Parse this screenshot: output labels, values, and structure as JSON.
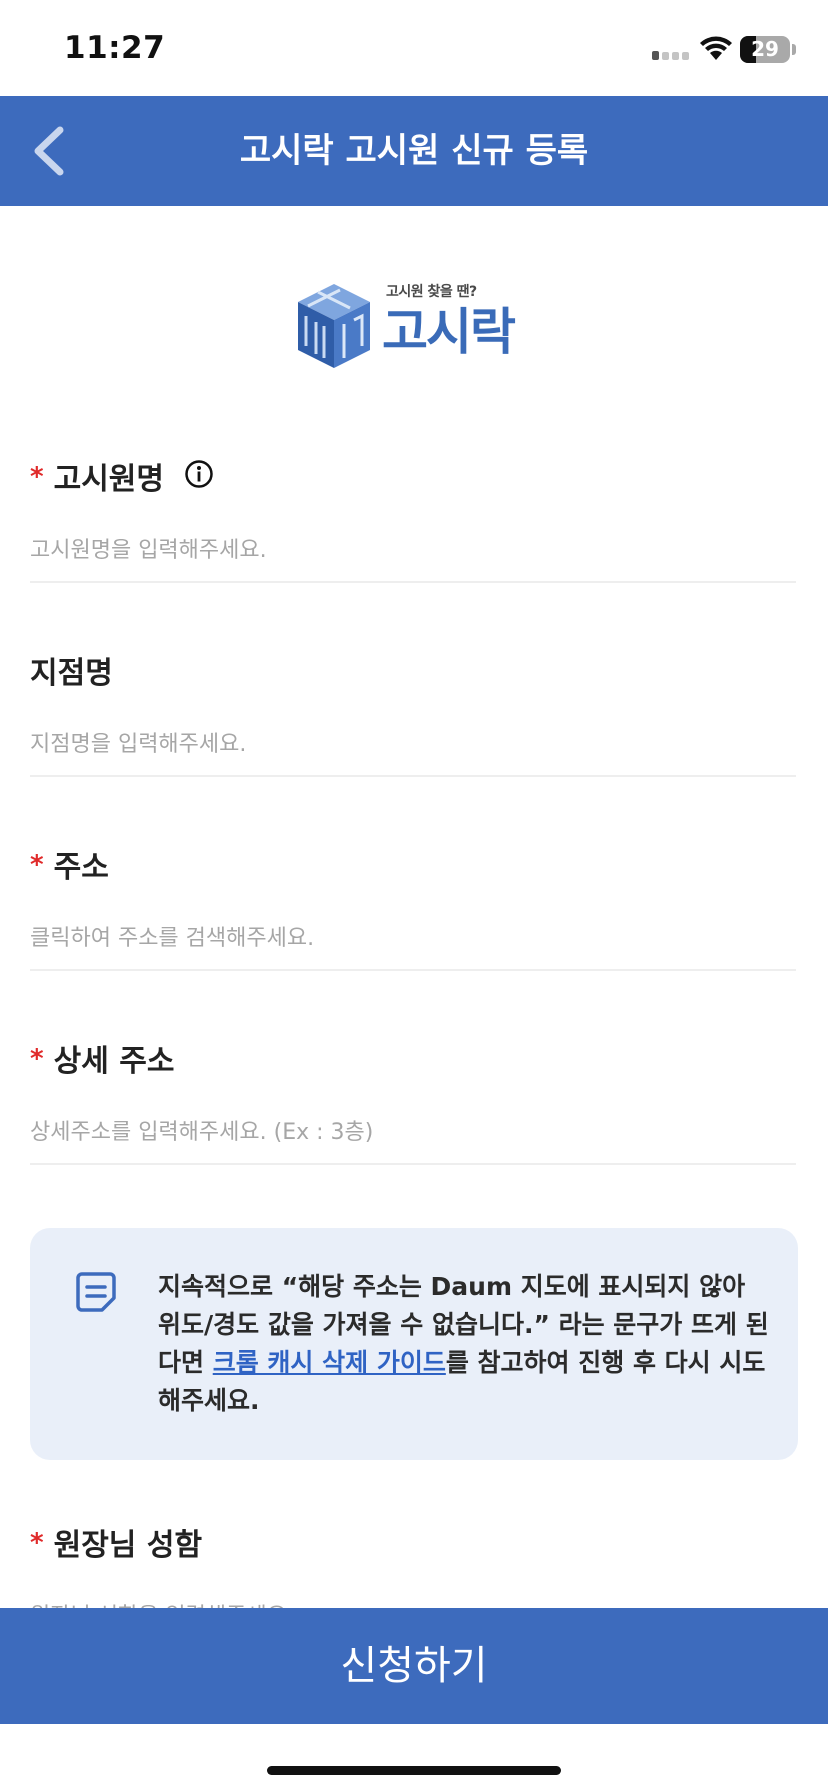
{
  "status_bar": {
    "time": "11:27",
    "battery": "29"
  },
  "header": {
    "title": "고시락 고시원 신규 등록"
  },
  "logo": {
    "tagline": "고시원 찾을 땐?",
    "wordmark": "고시락"
  },
  "fields": [
    {
      "label": "고시원명",
      "required": true,
      "required_mark": "*",
      "has_info": true,
      "placeholder": "고시원명을 입력해주세요.",
      "value": ""
    },
    {
      "label": "지점명",
      "required": false,
      "placeholder": "지점명을 입력해주세요.",
      "value": ""
    },
    {
      "label": "주소",
      "required": true,
      "required_mark": "*",
      "placeholder": "클릭하여 주소를 검색해주세요.",
      "value": ""
    },
    {
      "label": "상세 주소",
      "required": true,
      "required_mark": "*",
      "placeholder": "상세주소를 입력해주세요. (Ex : 3층)",
      "value": ""
    },
    {
      "label": "원장님 성함",
      "required": true,
      "required_mark": "*",
      "placeholder": "원장님 성함을 입력해주세요.",
      "value": ""
    }
  ],
  "notice": {
    "text_before": "지속적으로 “해당 주소는 Daum 지도에 표시되지 않아 위도/경도 값을 가져올 수 없습니다.” 라는 문구가 뜨게 된다면 ",
    "link": "크롬 캐시 삭제 가이드",
    "text_after": "를 참고하여 진행 후 다시 시도해주세요."
  },
  "submit": {
    "label": "신청하기"
  },
  "colors": {
    "primary": "#3d6bbd",
    "required": "#e02a2a",
    "notice_bg": "#e9eff9",
    "link": "#2f63c4"
  }
}
